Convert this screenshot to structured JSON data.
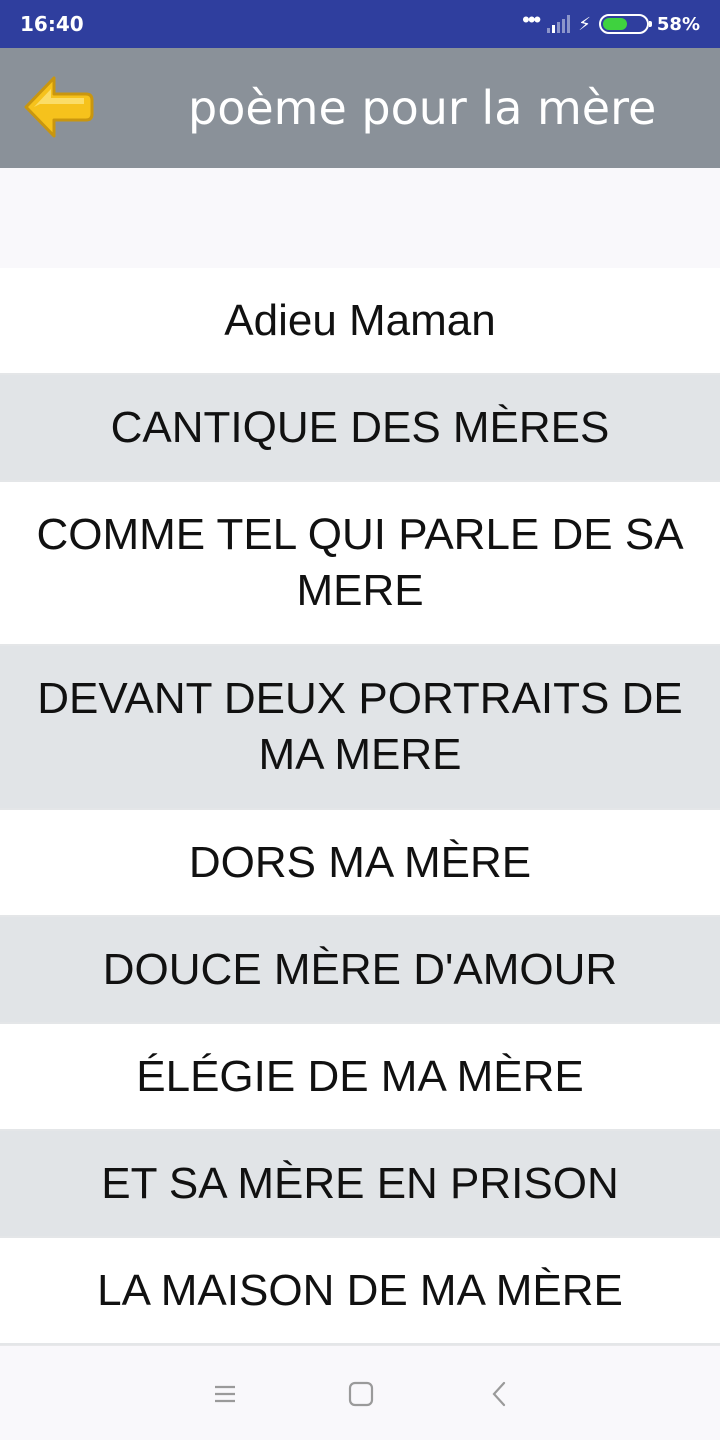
{
  "status": {
    "time": "16:40",
    "battery_percent": "58%",
    "battery_level": 0.58,
    "icons": [
      "more-dots-icon",
      "signal-icon",
      "charging-bolt-icon",
      "battery-icon"
    ]
  },
  "toolbar": {
    "title": "poème pour la mère",
    "back_icon": "back-arrow-icon",
    "back_color": "#f6c21c"
  },
  "poems": [
    {
      "title": "Adieu Maman"
    },
    {
      "title": "CANTIQUE DES MÈRES"
    },
    {
      "title": "COMME TEL QUI PARLE DE SA MERE"
    },
    {
      "title": "DEVANT DEUX PORTRAITS DE MA MERE"
    },
    {
      "title": "DORS MA MÈRE"
    },
    {
      "title": "DOUCE MÈRE D'AMOUR"
    },
    {
      "title": "ÉLÉGIE DE MA MÈRE"
    },
    {
      "title": "ET SA MÈRE EN PRISON"
    },
    {
      "title": "LA MAISON DE MA MÈRE"
    }
  ],
  "nav": {
    "icons": [
      "menu-icon",
      "home-icon",
      "back-icon"
    ]
  },
  "colors": {
    "status_bar": "#2f3e9e",
    "toolbar": "#8a9199",
    "row_alt": "#e1e4e7"
  }
}
